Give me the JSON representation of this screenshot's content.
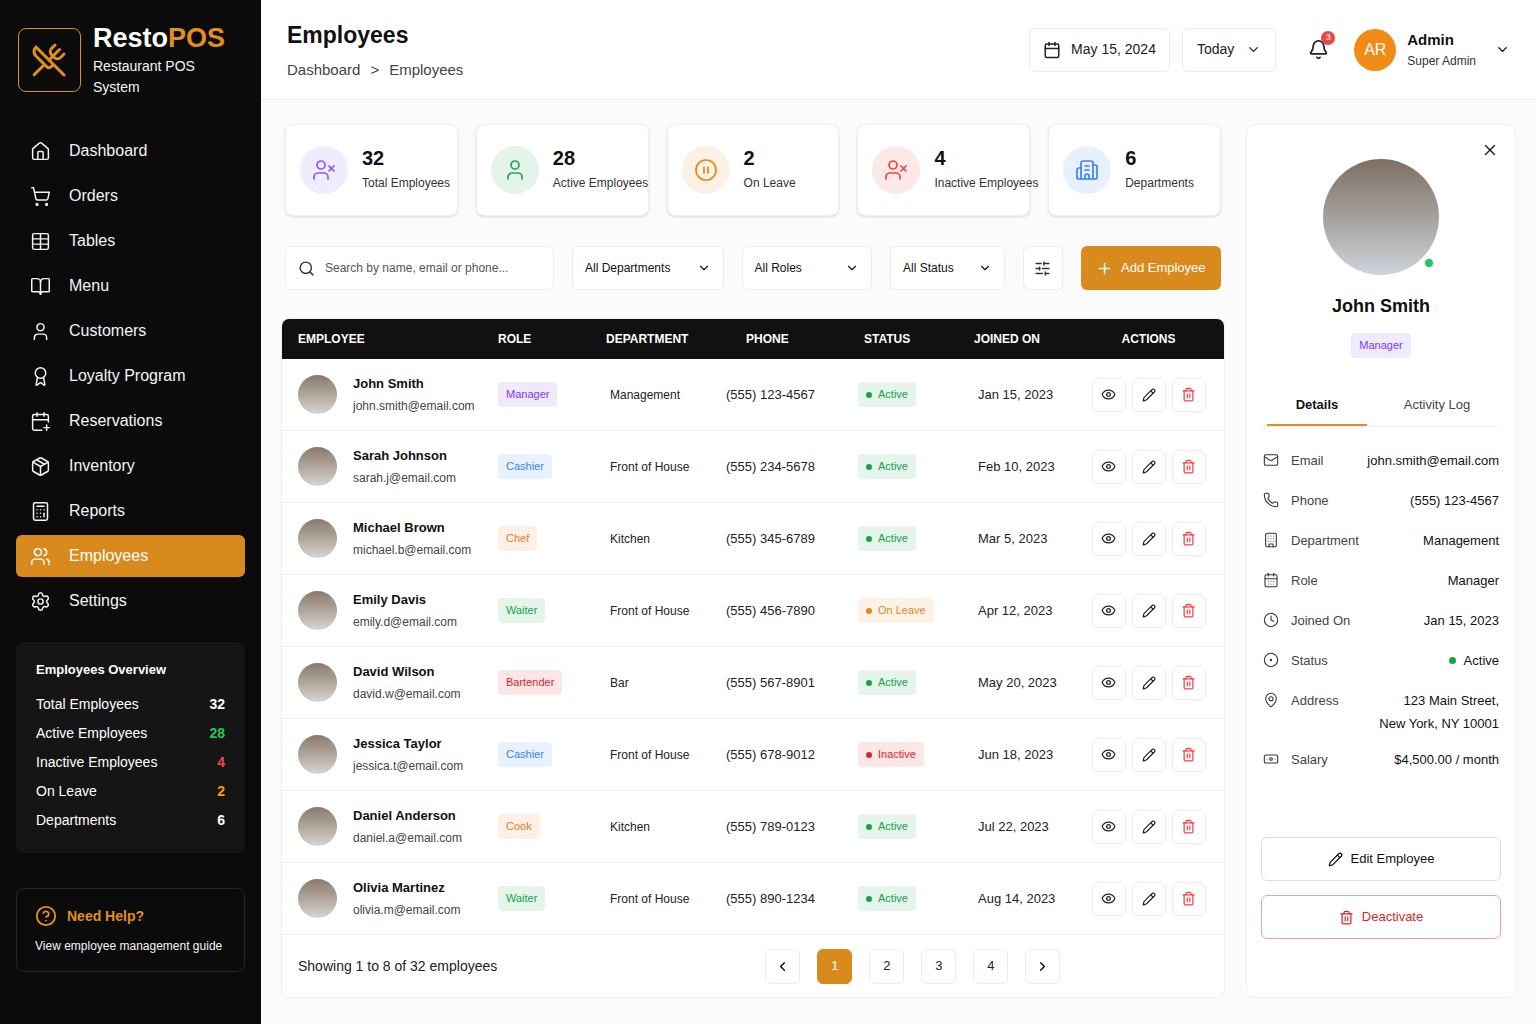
{
  "brand": {
    "name_first": "Resto",
    "name_second": "POS",
    "subtitle": "Restaurant POS System"
  },
  "sidebar": {
    "items": [
      {
        "label": "Dashboard",
        "selected": false
      },
      {
        "label": "Orders",
        "selected": false
      },
      {
        "label": "Tables",
        "selected": false
      },
      {
        "label": "Menu",
        "selected": false
      },
      {
        "label": "Customers",
        "selected": false
      },
      {
        "label": "Loyalty Program",
        "selected": false
      },
      {
        "label": "Reservations",
        "selected": false
      },
      {
        "label": "Inventory",
        "selected": false
      },
      {
        "label": "Reports",
        "selected": false
      },
      {
        "label": "Employees",
        "selected": true
      },
      {
        "label": "Settings",
        "selected": false
      }
    ]
  },
  "overview": {
    "title": "Employees Overview",
    "rows": [
      {
        "label": "Total Employees",
        "value": "32",
        "color": "#ffffff"
      },
      {
        "label": "Active Employees",
        "value": "28",
        "color": "#22c55e"
      },
      {
        "label": "Inactive Employees",
        "value": "4",
        "color": "#ef4444"
      },
      {
        "label": "On Leave",
        "value": "2",
        "color": "#f59e0b"
      },
      {
        "label": "Departments",
        "value": "6",
        "color": "#ffffff"
      }
    ]
  },
  "help": {
    "title": "Need Help?",
    "text": "View employee management guide"
  },
  "header": {
    "title": "Employees",
    "breadcrumb": [
      "Dashboard",
      "Employees"
    ],
    "separator": ">",
    "date": "May 15, 2024",
    "range": "Today",
    "notifications": "3",
    "avatar_initials": "AR",
    "user_name": "Admin",
    "user_role": "Super Admin"
  },
  "stats": [
    {
      "value": "32",
      "label": "Total Employees",
      "color": "#8b5cf6"
    },
    {
      "value": "28",
      "label": "Active Employees",
      "color": "#22a55a"
    },
    {
      "value": "2",
      "label": "On Leave",
      "color": "#e08a1e"
    },
    {
      "value": "4",
      "label": "Inactive Employees",
      "color": "#ef4444"
    },
    {
      "value": "6",
      "label": "Departments",
      "color": "#3b82f6"
    }
  ],
  "filters": {
    "search_placeholder": "Search by name, email or phone...",
    "dropdowns": [
      "All Departments",
      "All Roles",
      "All Status"
    ],
    "add_button": "Add Employee"
  },
  "table": {
    "columns": [
      "EMPLOYEE",
      "ROLE",
      "DEPARTMENT",
      "PHONE",
      "STATUS",
      "JOINED ON",
      "ACTIONS"
    ],
    "rows": [
      {
        "name": "John Smith",
        "email": "john.smith@email.com",
        "role": "Manager",
        "role_color": "#7c3aed",
        "department": "Management",
        "phone": "(555) 123-4567",
        "status": "Active",
        "status_color": "#16a34a",
        "joined": "Jan 15, 2023"
      },
      {
        "name": "Sarah Johnson",
        "email": "sarah.j@email.com",
        "role": "Cashier",
        "role_color": "#3b82f6",
        "department": "Front of House",
        "phone": "(555) 234-5678",
        "status": "Active",
        "status_color": "#16a34a",
        "joined": "Feb 10, 2023"
      },
      {
        "name": "Michael Brown",
        "email": "michael.b@email.com",
        "role": "Chef",
        "role_color": "#ea7a1a",
        "department": "Kitchen",
        "phone": "(555) 345-6789",
        "status": "Active",
        "status_color": "#16a34a",
        "joined": "Mar 5, 2023"
      },
      {
        "name": "Emily Davis",
        "email": "emily.d@email.com",
        "role": "Waiter",
        "role_color": "#16a34a",
        "department": "Front of House",
        "phone": "(555) 456-7890",
        "status": "On Leave",
        "status_color": "#e08a1e",
        "joined": "Apr 12, 2023"
      },
      {
        "name": "David Wilson",
        "email": "david.w@email.com",
        "role": "Bartender",
        "role_color": "#dc2626",
        "department": "Bar",
        "phone": "(555) 567-8901",
        "status": "Active",
        "status_color": "#16a34a",
        "joined": "May 20, 2023"
      },
      {
        "name": "Jessica Taylor",
        "email": "jessica.t@email.com",
        "role": "Cashier",
        "role_color": "#3b82f6",
        "department": "Front of House",
        "phone": "(555) 678-9012",
        "status": "Inactive",
        "status_color": "#dc2626",
        "joined": "Jun 18, 2023"
      },
      {
        "name": "Daniel Anderson",
        "email": "daniel.a@email.com",
        "role": "Cook",
        "role_color": "#ea7a1a",
        "department": "Kitchen",
        "phone": "(555) 789-0123",
        "status": "Active",
        "status_color": "#16a34a",
        "joined": "Jul 22, 2023"
      },
      {
        "name": "Olivia Martinez",
        "email": "olivia.m@email.com",
        "role": "Waiter",
        "role_color": "#16a34a",
        "department": "Front of House",
        "phone": "(555) 890-1234",
        "status": "Active",
        "status_color": "#16a34a",
        "joined": "Aug 14, 2023"
      }
    ],
    "showing": "Showing 1 to 8 of 32 employees",
    "pages": [
      {
        "label": "1",
        "selected": true
      },
      {
        "label": "2",
        "selected": false
      },
      {
        "label": "3",
        "selected": false
      },
      {
        "label": "4",
        "selected": false
      }
    ]
  },
  "detail": {
    "name": "John Smith",
    "role": "Manager",
    "role_color": "#7c3aed",
    "online": true,
    "tabs": [
      {
        "label": "Details",
        "selected": true
      },
      {
        "label": "Activity Log",
        "selected": false
      }
    ],
    "fields": [
      {
        "kind": "text",
        "label": "Email",
        "value": "john.smith@email.com"
      },
      {
        "kind": "text",
        "label": "Phone",
        "value": "(555) 123-4567"
      },
      {
        "kind": "text",
        "label": "Department",
        "value": "Management"
      },
      {
        "kind": "text",
        "label": "Role",
        "value": "Manager"
      },
      {
        "kind": "text",
        "label": "Joined On",
        "value": "Jan 15, 2023"
      },
      {
        "kind": "status",
        "label": "Status",
        "value": "Active",
        "color": "#16a34a"
      },
      {
        "kind": "lines",
        "label": "Address",
        "lines": [
          "123 Main Street,",
          "New York, NY 10001"
        ]
      },
      {
        "kind": "text",
        "label": "Salary",
        "value": "$4,500.00 / month"
      }
    ],
    "edit_button": "Edit Employee",
    "deactivate_button": "Deactivate"
  }
}
